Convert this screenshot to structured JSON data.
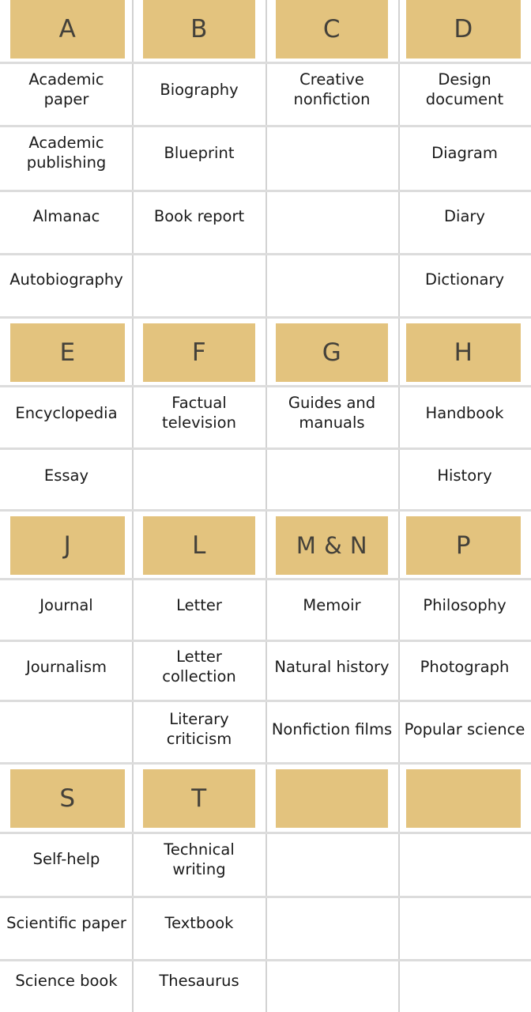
{
  "meta": {
    "title": "Nonfiction genres A–Z index table",
    "accent_color": "#e3c37e",
    "header_text_color": "#44413a",
    "body_text_color": "#1a1a1a",
    "separator_color": "#dcdcdc",
    "columns": 4
  },
  "blocks": [
    {
      "id": "block-abcd",
      "headers": [
        "A",
        "B",
        "C",
        "D"
      ],
      "rows": [
        [
          "Academic paper",
          "Biography",
          "Creative nonfiction",
          "Design document"
        ],
        [
          "Academic publishing",
          "Blueprint",
          "",
          "Diagram"
        ],
        [
          "Almanac",
          "Book report",
          "",
          "Diary"
        ],
        [
          "Autobiography",
          "",
          "",
          "Dictionary"
        ]
      ]
    },
    {
      "id": "block-efgh",
      "headers": [
        "E",
        "F",
        "G",
        "H"
      ],
      "rows": [
        [
          "Encyclopedia",
          "Factual television",
          "Guides and manuals",
          "Handbook"
        ],
        [
          "Essay",
          "",
          "",
          "History"
        ]
      ]
    },
    {
      "id": "block-jlmnp",
      "headers": [
        "J",
        "L",
        "M & N",
        "P"
      ],
      "rows": [
        [
          "Journal",
          "Letter",
          "Memoir",
          "Philosophy"
        ],
        [
          "Journalism",
          "Letter collection",
          "Natural history",
          "Photograph"
        ],
        [
          "",
          "Literary criticism",
          "Nonfiction films",
          "Popular science"
        ]
      ]
    },
    {
      "id": "block-st",
      "headers": [
        "S",
        "T",
        "",
        ""
      ],
      "rows": [
        [
          "Self-help",
          "Technical writing",
          "",
          ""
        ],
        [
          "Scientific paper",
          "Textbook",
          "",
          ""
        ],
        [
          "Science book",
          "Thesaurus",
          "",
          ""
        ]
      ]
    }
  ]
}
